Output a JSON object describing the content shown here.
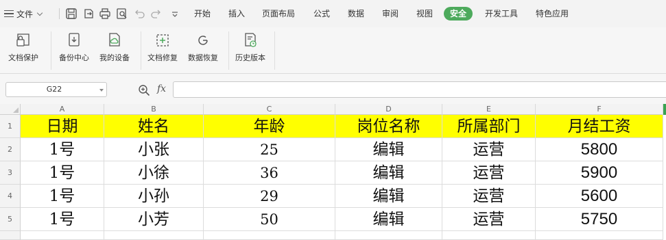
{
  "menubar": {
    "file_label": "文件",
    "tabs": [
      {
        "label": "开始",
        "active": false
      },
      {
        "label": "插入",
        "active": false
      },
      {
        "label": "页面布局",
        "active": false
      },
      {
        "label": "公式",
        "active": false
      },
      {
        "label": "数据",
        "active": false
      },
      {
        "label": "审阅",
        "active": false
      },
      {
        "label": "视图",
        "active": false
      },
      {
        "label": "安全",
        "active": true
      },
      {
        "label": "开发工具",
        "active": false
      },
      {
        "label": "特色应用",
        "active": false
      }
    ],
    "active_tab_color": "#4daa5c"
  },
  "ribbon": {
    "buttons": [
      {
        "label": "文档保护",
        "icon": "shield-icon"
      },
      {
        "label": "备份中心",
        "icon": "backup-icon"
      },
      {
        "label": "我的设备",
        "icon": "cloud-document-icon"
      },
      {
        "label": "文档修复",
        "icon": "document-repair-icon"
      },
      {
        "label": "数据恢复",
        "icon": "data-recovery-icon"
      },
      {
        "label": "历史版本",
        "icon": "history-version-icon"
      }
    ]
  },
  "formula_bar": {
    "name_box": "G22",
    "fx_label": "fx",
    "formula": ""
  },
  "sheet": {
    "columns": [
      "A",
      "B",
      "C",
      "D",
      "E",
      "F"
    ],
    "rows": [
      "1",
      "2",
      "3",
      "4",
      "5"
    ],
    "header_fill": "#ffff00",
    "header": [
      "日期",
      "姓名",
      "年龄",
      "岗位名称",
      "所属部门",
      "月结工资"
    ],
    "data": [
      [
        "1号",
        "小张",
        "25",
        "编辑",
        "运营",
        "5800"
      ],
      [
        "1号",
        "小徐",
        "36",
        "编辑",
        "运营",
        "5900"
      ],
      [
        "1号",
        "小孙",
        "29",
        "编辑",
        "运营",
        "5600"
      ],
      [
        "1号",
        "小芳",
        "50",
        "编辑",
        "运营",
        "5750"
      ]
    ]
  }
}
